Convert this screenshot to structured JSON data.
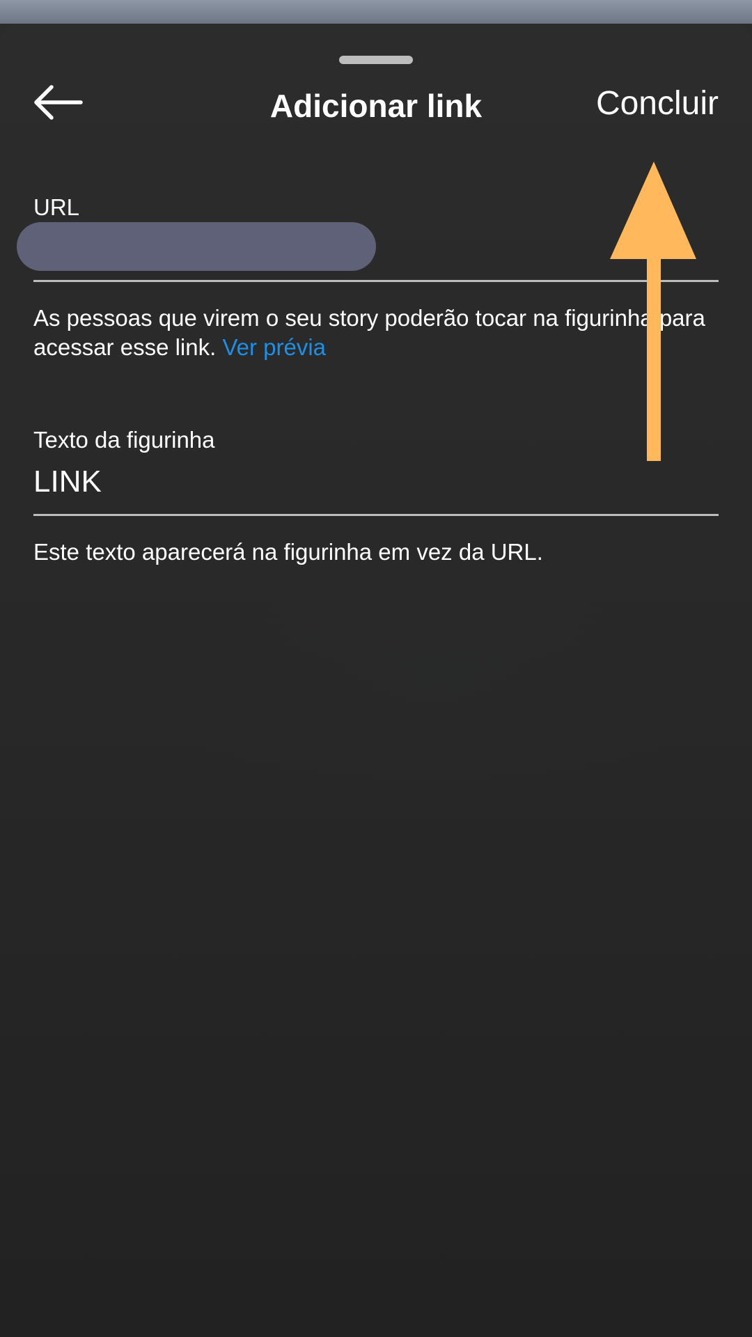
{
  "header": {
    "title": "Adicionar link",
    "done_label": "Concluir"
  },
  "url_field": {
    "label": "URL",
    "value_redacted": true
  },
  "url_help": {
    "text": "As pessoas que virem o seu story poderão tocar na figurinha para acessar esse link. ",
    "preview_link": "Ver prévia"
  },
  "sticker_field": {
    "label": "Texto da figurinha",
    "value": "LINK",
    "help": "Este texto aparecerá na figurinha em vez da URL."
  },
  "colors": {
    "link_blue": "#1e8fe6",
    "annotation_arrow": "#ffb85c",
    "redaction": "#5f6179"
  },
  "icons": {
    "back": "arrow-left-icon",
    "annotation": "arrow-up-icon"
  }
}
